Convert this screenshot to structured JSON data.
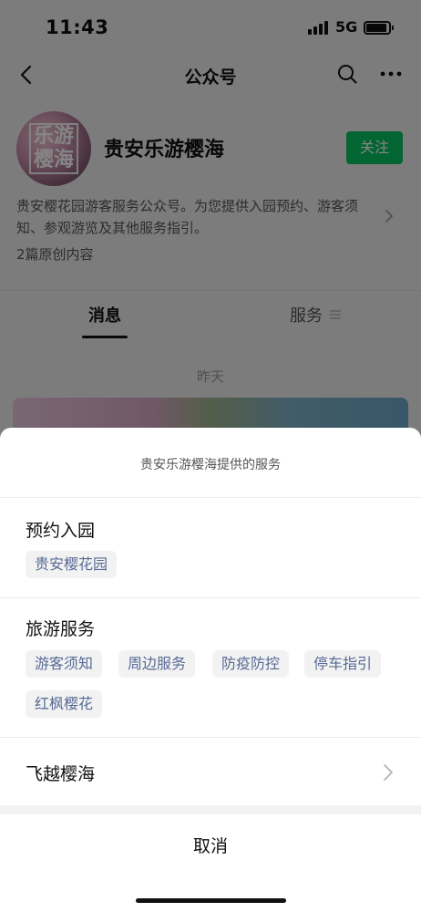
{
  "status_bar": {
    "time": "11:43",
    "network": "5G"
  },
  "nav": {
    "title": "公众号"
  },
  "profile": {
    "avatar_text": "乐游樱海",
    "name": "贵安乐游樱海",
    "follow_label": "关注",
    "intro": "贵安樱花园游客服务公众号。为您提供入园预约、游客须知、参观游览及其他服务指引。",
    "original_count": "2篇原创内容"
  },
  "tabs": {
    "messages": "消息",
    "services": "服务"
  },
  "feed": {
    "date": "昨天"
  },
  "sheet": {
    "title": "贵安乐游樱海提供的服务",
    "sections": [
      {
        "title": "预约入园",
        "items": [
          "贵安樱花园"
        ]
      },
      {
        "title": "旅游服务",
        "items": [
          "游客须知",
          "周边服务",
          "防疫防控",
          "停车指引",
          "红枫樱花"
        ]
      },
      {
        "title": "飞越樱海",
        "items": []
      }
    ],
    "cancel_label": "取消"
  },
  "colors": {
    "accent_green": "#07c160",
    "link_blue": "#576b95"
  }
}
